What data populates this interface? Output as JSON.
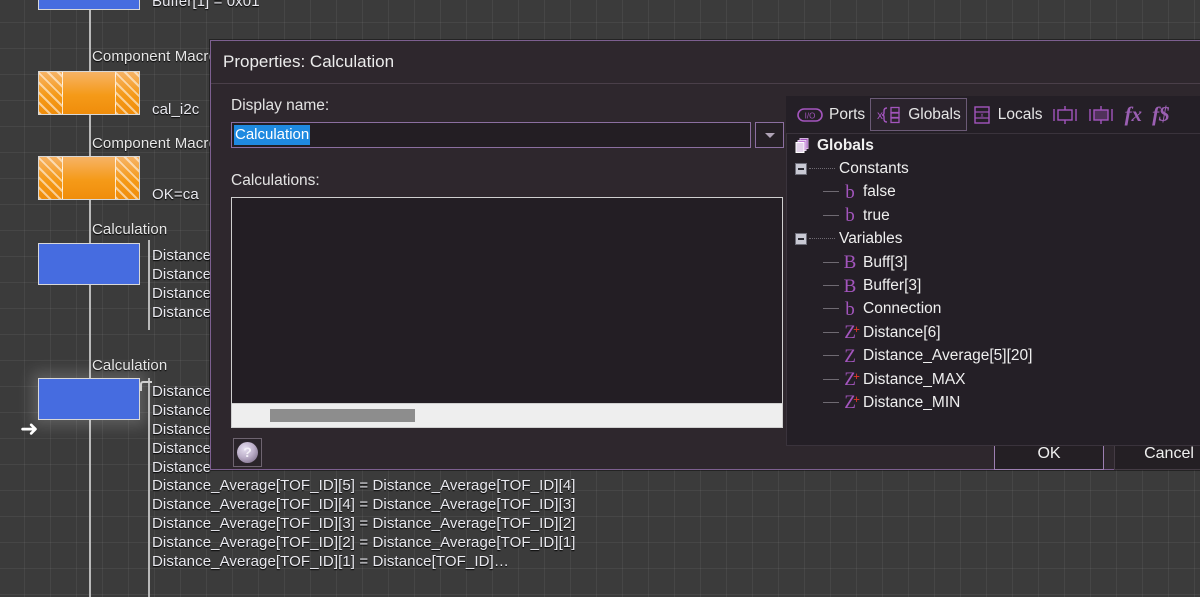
{
  "canvas": {
    "blocks": [
      {
        "caption": "",
        "code": [
          "Buffer[1] = 0x01"
        ],
        "type": "blue"
      },
      {
        "caption": "Component Macro",
        "code": [
          "cal_i2c"
        ],
        "type": "orange"
      },
      {
        "caption": "Component Macro",
        "code": [
          "OK=ca"
        ],
        "type": "orange"
      },
      {
        "caption": "Calculation",
        "code": [
          "Distance",
          "Distance",
          "Distance",
          "Distance"
        ],
        "type": "blue"
      },
      {
        "caption": "Calculation",
        "code": [
          "Distance",
          "Distance",
          "Distance",
          "Distance",
          "Distance"
        ],
        "type": "blue"
      }
    ],
    "code_lines": [
      "Distance_Average[TOF_ID][5] = Distance_Average[TOF_ID][4]",
      "Distance_Average[TOF_ID][4] = Distance_Average[TOF_ID][3]",
      "Distance_Average[TOF_ID][3] = Distance_Average[TOF_ID][2]",
      "Distance_Average[TOF_ID][2] = Distance_Average[TOF_ID][1]",
      "Distance_Average[TOF_ID][1] = Distance[TOF_ID]…"
    ]
  },
  "dialog": {
    "title": "Properties: Calculation",
    "display_name_label": "Display name:",
    "display_name_value": "Calculation",
    "calculations_label": "Calculations:",
    "calculations_value": "",
    "help_glyph": "?",
    "ok_label": "OK",
    "cancel_label": "Cancel"
  },
  "panel": {
    "toolbar": [
      {
        "icon": "ports-io-icon",
        "label": "Ports",
        "active": false
      },
      {
        "icon": "globals-icon",
        "label": "Globals",
        "active": true
      },
      {
        "icon": "locals-icon",
        "label": "Locals",
        "active": false
      },
      {
        "icon": "macro-in-icon",
        "label": "",
        "active": false
      },
      {
        "icon": "macro-out-icon",
        "label": "",
        "active": false
      },
      {
        "icon": "fx-icon",
        "label": "",
        "active": false
      },
      {
        "icon": "fs-icon",
        "label": "",
        "active": false
      }
    ],
    "tree": [
      {
        "depth": 0,
        "kind": "root",
        "icon": "globals-stack-icon",
        "label": "Globals"
      },
      {
        "depth": 1,
        "kind": "group",
        "icon": "expander-minus",
        "label": "Constants"
      },
      {
        "depth": 2,
        "kind": "bool",
        "icon": "b",
        "label": "false"
      },
      {
        "depth": 2,
        "kind": "bool-last",
        "icon": "b",
        "label": "true"
      },
      {
        "depth": 1,
        "kind": "group",
        "icon": "expander-minus",
        "label": "Variables"
      },
      {
        "depth": 2,
        "kind": "byte",
        "icon": "B",
        "label": "Buff[3]"
      },
      {
        "depth": 2,
        "kind": "byte",
        "icon": "B",
        "label": "Buffer[3]"
      },
      {
        "depth": 2,
        "kind": "bool",
        "icon": "b",
        "label": "Connection"
      },
      {
        "depth": 2,
        "kind": "uint",
        "icon": "Z+",
        "label": "Distance[6]"
      },
      {
        "depth": 2,
        "kind": "int",
        "icon": "Z",
        "label": "Distance_Average[5][20]"
      },
      {
        "depth": 2,
        "kind": "uint",
        "icon": "Z+",
        "label": "Distance_MAX"
      },
      {
        "depth": 2,
        "kind": "uint",
        "icon": "Z+",
        "label": "Distance_MIN"
      }
    ]
  },
  "colors": {
    "dialog_bg": "#2e272d",
    "dialog_border": "#7d5f90",
    "accent_purple": "#a355bd",
    "selection_blue": "#1f8ae0",
    "block_blue": "#466ce0",
    "block_orange": "#f59a18",
    "canvas_bg": "#3b3b3b"
  }
}
